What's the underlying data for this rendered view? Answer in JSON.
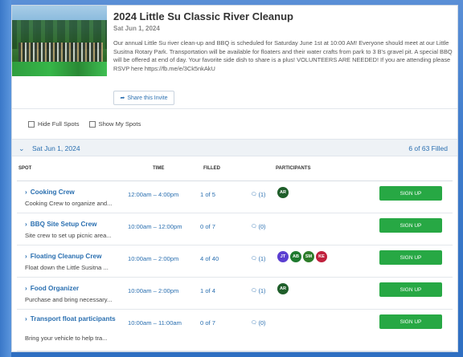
{
  "event": {
    "title": "2024 Little Su Classic River Cleanup",
    "date": "Sat Jun 1, 2024",
    "description": "Our annual Little Su river clean-up and BBQ is scheduled for Saturday June 1st at 10:00 AM! Everyone should meet at our Little Susitna Rotary Park. Transportation will be available for floaters and their water crafts from park to 3 B's gravel pit. A special BBQ will be offered at end of day. Your favorite side dish to share is a plus! VOLUNTEERS ARE NEEDED! If you are attending please RSVP here https://fb.me/e/3Ck5nkAkU",
    "share_label": "Share this Invite"
  },
  "filters": {
    "hide_full": "Hide Full Spots",
    "show_mine": "Show My Spots"
  },
  "group": {
    "date": "Sat Jun 1, 2024",
    "filled": "6 of 63 Filled"
  },
  "columns": {
    "spot": "SPOT",
    "time": "TIME",
    "filled": "FILLED",
    "participants": "PARTICIPANTS"
  },
  "signup_label": "SIGN UP",
  "rows": [
    {
      "title": "Cooking Crew",
      "desc": "Cooking Crew to organize and...",
      "time": "12:00am – 4:00pm",
      "filled": "1 of 5",
      "comments": "(1)",
      "avatars": [
        {
          "initials": "AR",
          "color": "#1f5e2a"
        }
      ]
    },
    {
      "title": "BBQ Site Setup Crew",
      "desc": "Site crew to set up picnic area...",
      "time": "10:00am – 12:00pm",
      "filled": "0 of 7",
      "comments": "(0)",
      "avatars": []
    },
    {
      "title": "Floating Cleanup Crew",
      "desc": "Float down the Little Susitna ...",
      "time": "10:00am – 2:00pm",
      "filled": "4 of 40",
      "comments": "(1)",
      "avatars": [
        {
          "initials": "JT",
          "color": "#5b3fd1"
        },
        {
          "initials": "AB",
          "color": "#1f7a2f"
        },
        {
          "initials": "SM",
          "color": "#2d7d2a"
        },
        {
          "initials": "KE",
          "color": "#c0213d"
        }
      ]
    },
    {
      "title": "Food Organizer",
      "desc": "Purchase and bring necessary...",
      "time": "10:00am – 2:00pm",
      "filled": "1 of 4",
      "comments": "(1)",
      "avatars": [
        {
          "initials": "AR",
          "color": "#1f5e2a"
        }
      ]
    },
    {
      "title": "Transport float participants",
      "desc": "Bring your vehicle to help tra...",
      "time": "10:00am – 11:00am",
      "filled": "0 of 7",
      "comments": "(0)",
      "avatars": []
    }
  ]
}
